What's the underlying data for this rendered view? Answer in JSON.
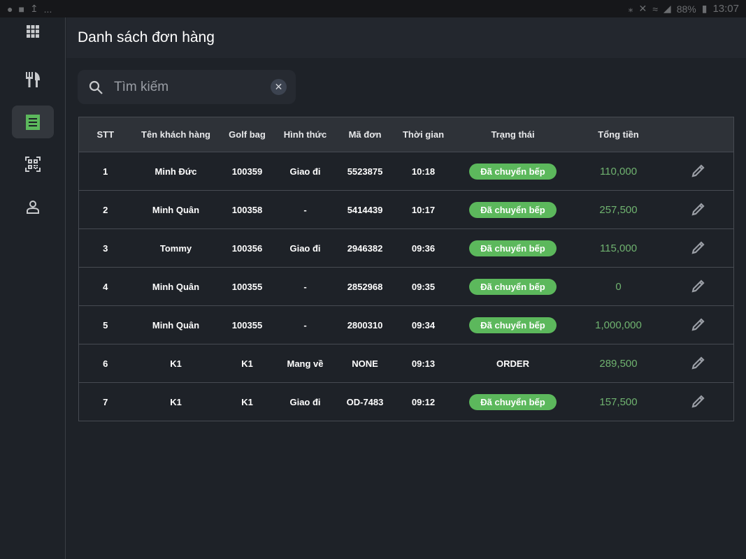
{
  "status_bar": {
    "battery": "88%",
    "time": "13:07",
    "more": "..."
  },
  "header": {
    "title": "Danh sách đơn hàng"
  },
  "search": {
    "placeholder": "Tìm kiếm",
    "value": ""
  },
  "colors": {
    "accent": "#5cb85c",
    "money": "#6fb26f"
  },
  "table": {
    "columns": [
      "STT",
      "Tên khách hàng",
      "Golf bag",
      "Hình thức",
      "Mã đơn",
      "Thời gian",
      "Trạng thái",
      "Tổng tiền",
      ""
    ],
    "rows": [
      {
        "stt": "1",
        "name": "Minh Đức",
        "bag": "100359",
        "type": "Giao đi",
        "code": "5523875",
        "time": "10:18",
        "status": "Đã chuyển bếp",
        "badge": true,
        "total": "110,000"
      },
      {
        "stt": "2",
        "name": "Minh Quân",
        "bag": "100358",
        "type": "-",
        "code": "5414439",
        "time": "10:17",
        "status": "Đã chuyển bếp",
        "badge": true,
        "total": "257,500"
      },
      {
        "stt": "3",
        "name": "Tommy",
        "bag": "100356",
        "type": "Giao đi",
        "code": "2946382",
        "time": "09:36",
        "status": "Đã chuyển bếp",
        "badge": true,
        "total": "115,000"
      },
      {
        "stt": "4",
        "name": "Minh Quân",
        "bag": "100355",
        "type": "-",
        "code": "2852968",
        "time": "09:35",
        "status": "Đã chuyển bếp",
        "badge": true,
        "total": "0"
      },
      {
        "stt": "5",
        "name": "Minh Quân",
        "bag": "100355",
        "type": "-",
        "code": "2800310",
        "time": "09:34",
        "status": "Đã chuyển bếp",
        "badge": true,
        "total": "1,000,000"
      },
      {
        "stt": "6",
        "name": "K1",
        "bag": "K1",
        "type": "Mang về",
        "code": "NONE",
        "time": "09:13",
        "status": "ORDER",
        "badge": false,
        "total": "289,500"
      },
      {
        "stt": "7",
        "name": "K1",
        "bag": "K1",
        "type": "Giao đi",
        "code": "OD-7483",
        "time": "09:12",
        "status": "Đã chuyển bếp",
        "badge": true,
        "total": "157,500"
      }
    ]
  }
}
